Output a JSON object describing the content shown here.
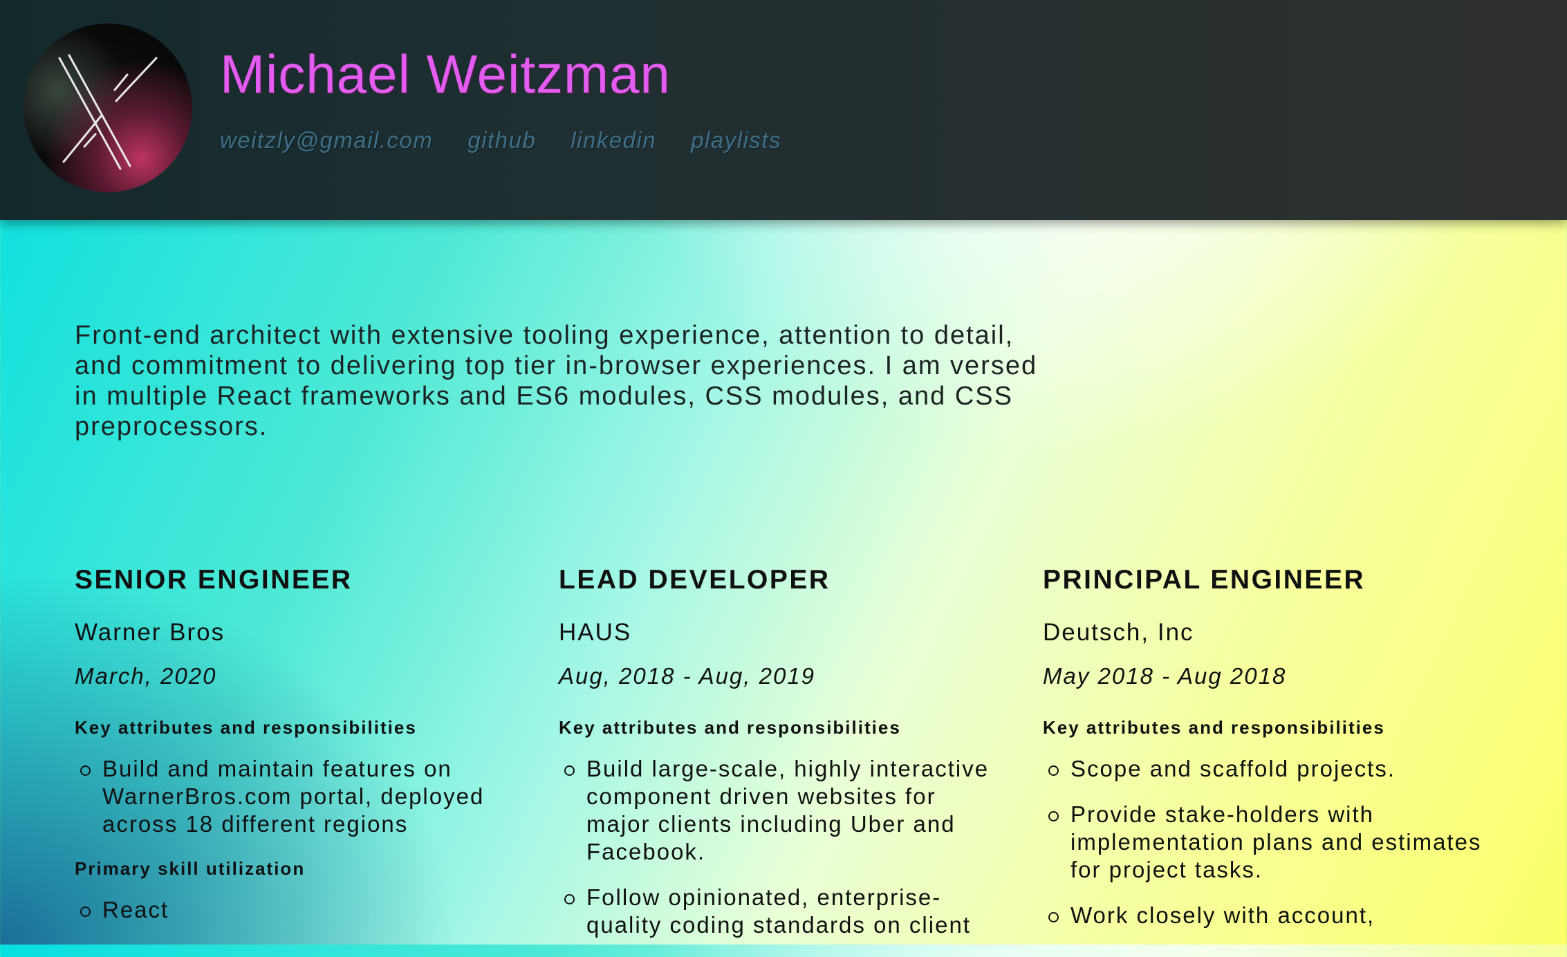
{
  "header": {
    "name": "Michael Weitzman",
    "links": [
      {
        "label": "weitzly@gmail.com"
      },
      {
        "label": "github"
      },
      {
        "label": "linkedin"
      },
      {
        "label": "playlists"
      }
    ]
  },
  "summary": "Front-end architect with extensive tooling experience, attention to detail, and commitment to delivering top tier in-browser experiences. I am versed in multiple React frameworks and ES6 modules, CSS modules, and CSS preprocessors.",
  "jobs": [
    {
      "title": "SENIOR ENGINEER",
      "company": "Warner Bros",
      "dates": "March, 2020",
      "responsibilities_heading": "Key attributes and responsibilities",
      "responsibilities": [
        "Build and maintain features on WarnerBros.com portal, deployed across 18 different regions"
      ],
      "skills_heading": "Primary skill utilization",
      "skills": [
        "React"
      ]
    },
    {
      "title": "LEAD DEVELOPER",
      "company": "HAUS",
      "dates": "Aug, 2018 - Aug, 2019",
      "responsibilities_heading": "Key attributes and responsibilities",
      "responsibilities": [
        "Build large-scale, highly interactive component driven websites for major clients including Uber and Facebook.",
        "Follow opinionated, enterprise-quality coding standards on client"
      ]
    },
    {
      "title": "PRINCIPAL ENGINEER",
      "company": "Deutsch, Inc",
      "dates": "May 2018 - Aug 2018",
      "responsibilities_heading": "Key attributes and responsibilities",
      "responsibilities": [
        "Scope and scaffold projects.",
        "Provide stake-holders with implementation plans and estimates for project tasks.",
        "Work closely with account,"
      ]
    }
  ],
  "colors": {
    "name": "#e45bf0",
    "links": "#3f6f88",
    "header_bg": "#1f2f31"
  }
}
